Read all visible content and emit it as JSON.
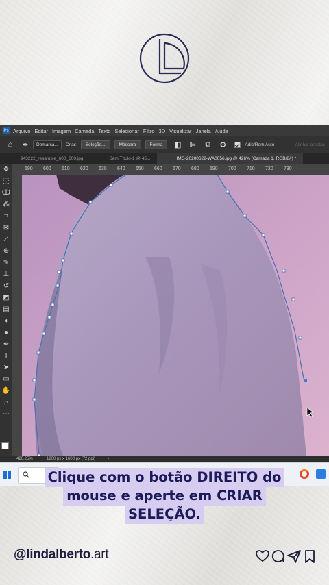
{
  "photoshop": {
    "menu": [
      "Arquivo",
      "Editar",
      "Imagem",
      "Camada",
      "Texto",
      "Selecionar",
      "Filtro",
      "3D",
      "Visualizar",
      "Janela",
      "Ajuda"
    ],
    "options_bar": {
      "pen_mode": "Demarca...",
      "criar_label": "Criar:",
      "selecao_btn": "Seleção...",
      "mascara_btn": "Máscara",
      "forma_btn": "Forma",
      "auto_add_delete": "Adic/Rem Auto",
      "align_edges": "Alinhar arestas"
    },
    "tabs": [
      {
        "label": "943222_resample_600_600.jpg"
      },
      {
        "label": "Sem Título-1 @ 45..."
      },
      {
        "label": "IMG-20200622-WA0056.jpg @ 426% (Camada 1, RGB/8#) *",
        "active": true
      }
    ],
    "ruler_ticks": [
      "590",
      "600",
      "610",
      "620",
      "630",
      "640",
      "650",
      "660",
      "670",
      "680",
      "690",
      "700",
      "710",
      "720",
      "730"
    ],
    "status": {
      "zoom": "426,25%",
      "dimensions": "1200 px x 1600 px (72 ppi)",
      "arrow": "›"
    }
  },
  "caption": {
    "line1": "Clique com o botão DIREITO do",
    "line2": "mouse e aperte em CRIAR",
    "line3": "SELEÇÃO."
  },
  "footer": {
    "handle_prefix": "@lindalberto",
    "handle_suffix": ".art"
  },
  "colors": {
    "caption_bg": "#d7cdf0",
    "caption_text": "#1b1b5a",
    "canvas_pink": "#c9a4c6",
    "path_blue": "#4a6fb3"
  }
}
